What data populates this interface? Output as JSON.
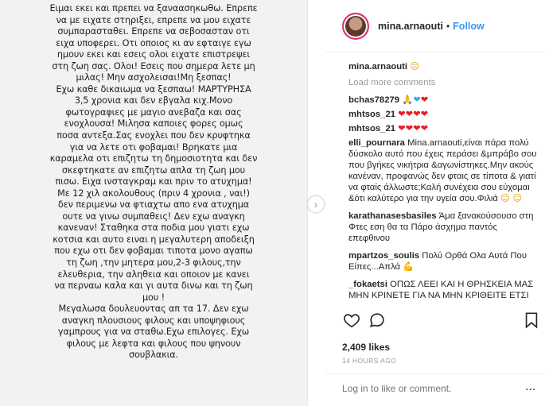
{
  "post_text_lines": [
    "Ειμαι εκει και πρεπει να ξαναασηκωθω. Επρεπε",
    "να με ειχατε στηριξει, επρεπε να μου ειχατε",
    "συμπαρασταθει. Επρεπε να σεβοσασταν οτι",
    "ειχα υποφερει. Οτι οποιος κι αν εφταιγε εγω",
    "ημουν εκει και εσεις ολοι ειχατε επιστρεψει",
    "στη ζωη σας. Ολοι! Εσεις που σημερα λετε μη",
    "μιλας! Μην ασχολεισαι!Μη ξεσπας!",
    "Εχω καθε δικαιωμα να ξεσπαω! ΜΑΡΤΥΡΗΣΑ",
    "3,5 χρονια και δεν εβγαλα κιχ.Μονο",
    "φωτογραφιες με μαγιο ανεβαζα και σας",
    "ενοχλουσα! Μιλησα καποιες φορες ομως",
    "ποσα αντεξα.Σας ενοχλει που δεν κρυφτηκα",
    "για να λετε οτι φοβαμαι! Βρηκατε μια",
    "καραμελα οτι επιζητω τη δημοσιοτητα και δεν",
    "σκεφτηκατε αν επιζητω απλα τη ζωη μου",
    "πισω. Ειχα ινσταγκραμ και πριν το ατυχημα!",
    "Με 12 χιλ ακολουθους (πριν 4 χρονια , ναι!)",
    "δεν περιμενω να φτιαχτω απο ενα ατυχημα",
    "ουτε να γινω συμπαθεις! Δεν εχω αναγκη",
    "κανεναν! Σταθηκα στα ποδια μου γιατι εχω",
    "κοτσια και αυτο ειναι η μεγαλυτερη αποδειξη",
    "που εχω οτι δεν φοβαμαι τιποτα μονο αγαπω",
    "τη ζωη ,την μητερα μου,2-3 φιλους,την",
    "ελευθερια, την αληθεια και οποιον με κανει",
    "να περναω καλα και γι αυτα δινω και τη ζωη",
    "μου !",
    "Μεγαλωσα δουλευοντας απ τα 17. Δεν εχω",
    "αναγκη πλουσιους φιλους και υποψηφιους",
    "γαμπρους για να σταθω.Εχω επιλογες. Εχω",
    "φιλους με λεφτα και φιλους που ψηνουν",
    "σουβλακια."
  ],
  "header": {
    "username": "mina.arnaouti",
    "separator": "•",
    "follow_label": "Follow"
  },
  "caption": {
    "username": "mina.arnaouti",
    "emoji": "☹"
  },
  "load_more_label": "Load more comments",
  "comments": [
    {
      "username": "bchas78279",
      "text": "",
      "emoji": "🙏💙❤"
    },
    {
      "username": "mhtsos_21",
      "text": "",
      "emoji": "❤❤❤❤"
    },
    {
      "username": "mhtsos_21",
      "text": "",
      "emoji": "❤❤❤❤"
    },
    {
      "username": "elli_pournara",
      "text": "Mina.arnaouti,είναι πάρα πολύ δύσκολο αυτό που έχεις περάσει &μπράβο σου που βγήκες νικήτρια &αγωνίστηκες.Μην ακούς κανέναν, προφανώς δεν φταις σε τίποτα & γιατί να φταίς άλλωστε;Καλή συνέχεια σου εύχομαι &ότι καλύτερο για την υγεία σου.Φιλιά",
      "emoji": "☺ ☺"
    },
    {
      "username": "karathanasesbasiles",
      "text": "Άμα ξανακούσουσο στη Φτες εση θα τα Πάρο άσχημα παντός επεφθινου",
      "emoji": ""
    },
    {
      "username": "mpartzos_soulis",
      "text": "Πολύ Ορθά Ολα Αυτά Που Είπες...Απλά",
      "emoji": "💪"
    },
    {
      "username": "_fokaetsi",
      "text": "ΟΠΩΣ ΛΕΕΙ ΚΑΙ Η ΘΡΗΣΚΕΙΑ ΜΑΣ ΜΗΝ ΚΡΙΝΕΤΕ ΓΙΑ ΝΑ ΜΗΝ ΚΡΙΘΕΙΤΕ ΕΤΣΙ",
      "emoji": ""
    }
  ],
  "actions": {
    "like_icon": "heart-outline-icon",
    "comment_icon": "comment-icon",
    "share_icon": "share-icon",
    "save_icon": "bookmark-icon"
  },
  "likes_text": "2,409 likes",
  "timestamp": "14 HOURS AGO",
  "comment_placeholder": "Log in to like or comment.",
  "more_label": "..."
}
